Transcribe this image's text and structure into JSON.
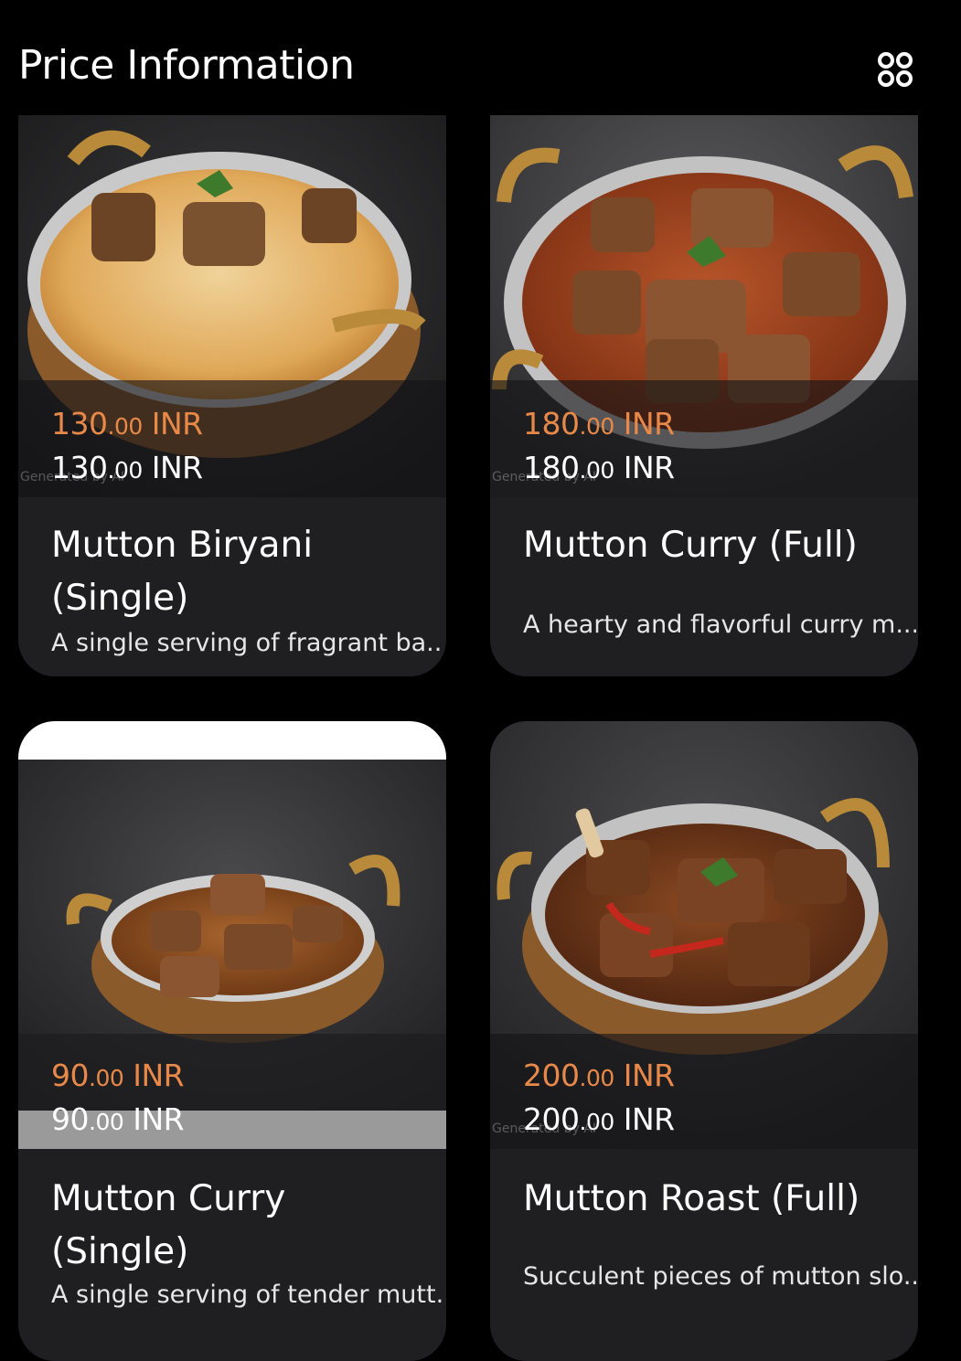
{
  "header": {
    "title": "Price Information",
    "view_toggle_icon": "grid-icon"
  },
  "watermark": "Generated by AI",
  "items": [
    {
      "name_line1": "Mutton Biryani",
      "name_line2": "(Single)",
      "price_int": "130",
      "price_dec": ".00",
      "currency": " INR",
      "description": "A single serving of fragrant ba..."
    },
    {
      "name_line1": "Mutton Curry (Full)",
      "price_int": "180",
      "price_dec": ".00",
      "currency": " INR",
      "description": "A hearty and flavorful curry m..."
    },
    {
      "name_line1": "Mutton Curry",
      "name_line2": "(Single)",
      "price_int": "90",
      "price_dec": ".00",
      "currency": " INR",
      "description": "A single serving of tender mutt.."
    },
    {
      "name_line1": "Mutton Roast (Full)",
      "price_int": "200",
      "price_dec": ".00",
      "currency": " INR",
      "description": "Succulent pieces of mutton slo..."
    }
  ],
  "colors": {
    "background": "#000000",
    "card": "#1f1f21",
    "price_accent": "#e8894a"
  }
}
